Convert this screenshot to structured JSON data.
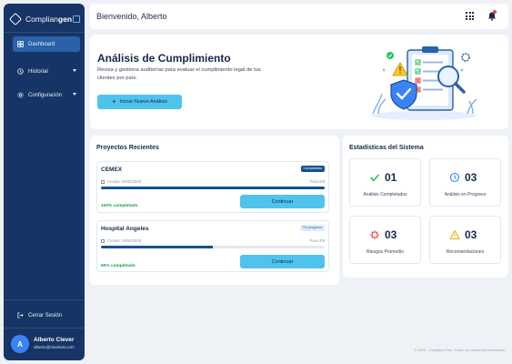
{
  "brand": {
    "part1": "Complian",
    "part2": "gen"
  },
  "sidebar": {
    "items": [
      {
        "label": "Dashboard",
        "icon": "grid-icon",
        "active": true
      },
      {
        "label": "Historial",
        "icon": "history-icon",
        "active": false
      },
      {
        "label": "Configuración",
        "icon": "gear-icon",
        "active": false
      }
    ],
    "logout_label": "Cerrar Sesión",
    "user": {
      "initial": "A",
      "name": "Alberto Clever",
      "email": "alberto@sharksis.com"
    }
  },
  "header": {
    "welcome": "Bienvenido, Alberto"
  },
  "hero": {
    "title": "Análisis de Cumplimiento",
    "description": "Revisa y gestiona auditorías para evaluar el cumplimiento legal de tus clientes por país.",
    "button_label": "Iniciar Nuevo Análisis"
  },
  "projects": {
    "title": "Proyectos Recientes",
    "items": [
      {
        "name": "CEMEX",
        "status": "Completado",
        "date": "Creado: 09/04/2026",
        "step": "Paso 8/8",
        "progress": 1.0,
        "progress_label": "100% completado",
        "button": "Continuar"
      },
      {
        "name": "Hospital Angeles",
        "status": "En progreso",
        "date": "Creado: 09/04/2026",
        "step": "Paso 4/8",
        "progress": 0.5,
        "progress_label": "50% completado",
        "button": "Continuar"
      }
    ]
  },
  "stats": {
    "title": "Estadísticas del Sistema",
    "items": [
      {
        "value": "01",
        "label": "Análisis Completados",
        "icon": "check-icon",
        "color": "#22c55e"
      },
      {
        "value": "03",
        "label": "Análisis en Progreso",
        "icon": "clock-icon",
        "color": "#3b82f6"
      },
      {
        "value": "03",
        "label": "Riesgos Promedio",
        "icon": "alert-star-icon",
        "color": "#ef4444"
      },
      {
        "value": "03",
        "label": "Recomendaciones",
        "icon": "warning-icon",
        "color": "#eab308"
      }
    ]
  },
  "footer": "© 2026 - Complian Gen. Todos los derechos reservados.",
  "colors": {
    "sidebar": "#163566",
    "accent": "#4fc3ec",
    "primary": "#15508f",
    "success": "#16a34a"
  }
}
